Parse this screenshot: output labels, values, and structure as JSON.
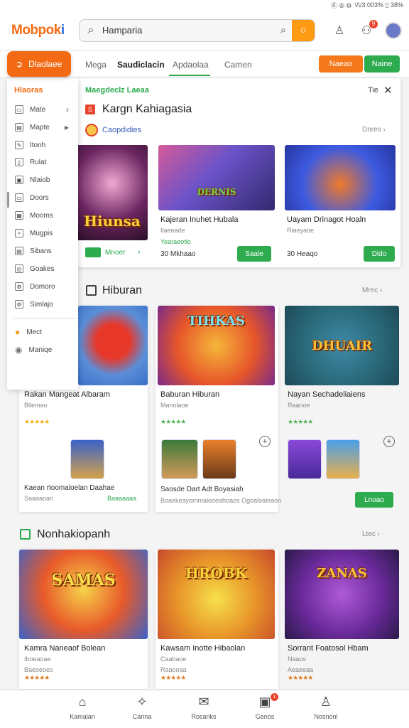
{
  "status": {
    "icons": "⓪ ✇ ⚙",
    "text": "\\/\\/3 003% ▯ 38%"
  },
  "app": {
    "logo_main": "Mobpok",
    "logo_tail": "i"
  },
  "search": {
    "value": "Hamparia"
  },
  "notifications": {
    "badge": "9"
  },
  "tabs": [
    {
      "label": "Mega"
    },
    {
      "label": "Saudiclacin"
    },
    {
      "label": "Apdaolaa"
    },
    {
      "label": "Camen"
    }
  ],
  "tab_buttons": {
    "orange": "Naeao",
    "green": "Naine"
  },
  "sidebar": {
    "button": "Dlaolaee",
    "head": "Hlaoras",
    "items": [
      {
        "label": "Mate",
        "icon": "card-icon",
        "glyph": "▭"
      },
      {
        "label": "Mapte",
        "icon": "map-icon",
        "glyph": "▤"
      },
      {
        "label": "Itonh",
        "icon": "edit-icon",
        "glyph": "✎"
      },
      {
        "label": "Rulat",
        "icon": "document-icon",
        "glyph": "▯"
      },
      {
        "label": "Nlaiob",
        "icon": "image-icon",
        "glyph": "▣"
      },
      {
        "label": "Doors",
        "icon": "door-icon",
        "glyph": "▭"
      },
      {
        "label": "Mooms",
        "icon": "gift-icon",
        "glyph": "▦"
      },
      {
        "label": "Mugpis",
        "icon": "search-icon",
        "glyph": "⌕"
      },
      {
        "label": "Sibans",
        "icon": "grid-icon",
        "glyph": "▤"
      },
      {
        "label": "Goakes",
        "icon": "game-icon",
        "glyph": "◎"
      },
      {
        "label": "Domoro",
        "icon": "settings-icon",
        "glyph": "⚙"
      },
      {
        "label": "Simlajo",
        "icon": "gear-icon",
        "glyph": "⚙"
      }
    ],
    "footer": [
      {
        "label": "Mect",
        "icon": "flame-icon"
      },
      {
        "label": "Maniqe",
        "icon": "profile-icon"
      }
    ]
  },
  "featured": {
    "top_label": "Maegdeclz  Laeaa",
    "top_right": "Tie",
    "title": "Kargn Kahiagasia",
    "subtitle": "Caopdidies",
    "more": "Dnres",
    "games": [
      {
        "art": "Hiunsa",
        "name": "",
        "sub": "",
        "price": "",
        "button": "Mnoer"
      },
      {
        "art": "DERNIS",
        "name": "Kajeran Inuhet Hubala",
        "sub": "Ilaeoade",
        "sub2": "Yearaeotlo",
        "price": "30 Mkhaao",
        "button": "Saale"
      },
      {
        "art": "",
        "name": "Uayam Drinagot Hoaln",
        "sub": "Riaeyaoe",
        "price": "30 Heaqo",
        "button": "Dldo"
      }
    ]
  },
  "section_hiburan": {
    "title": "Hiburan",
    "more": "Mrec",
    "games": [
      {
        "art": "",
        "name": "Rakan Mangeat Albaram",
        "sub": "Bllemao",
        "stars": "★★★★★",
        "sub_a": "Kaean rtoomaloelan  Daahae",
        "sub_b": "Saaaaoan",
        "sub_b_green": "Baaaaaaa"
      },
      {
        "art": "TIHKAS",
        "name": "Baburan Hiburan",
        "sub": "Manolaoe",
        "stars": "★★★★★",
        "sub_a": "Saosde Dart Adt Boyasiah",
        "sub_b": "Boaekeayommalooeahoaos Ogoaloaleaon"
      },
      {
        "art": "DHUAIR",
        "name": "Nayan Sechadeliaiens",
        "sub": "Raanoe",
        "stars": "★★★★★",
        "button": "Lnoao"
      }
    ]
  },
  "section_two": {
    "title": "Nonhakiopanh",
    "more": "Ltec",
    "games": [
      {
        "art": "SAMAS",
        "name": "Kamra Naneaof Bolean",
        "sub": "Iboeaoae",
        "sub2": "Baeoeoes",
        "stars": "★★★★★"
      },
      {
        "art": "HROBK",
        "name": "Kawsam Inotte Hibaolan",
        "sub": "Caabaoe",
        "sub2": "Raaooaa",
        "stars": "★★★★★"
      },
      {
        "art": "ZANAS",
        "name": "Sorrant Foatosol Hbam",
        "sub": "Naaos",
        "sub2": "Aeaeeaa",
        "stars": "★★★★★"
      }
    ]
  },
  "bottom_nav": [
    {
      "label": "Kamalan",
      "icon": "home-icon",
      "glyph": "⌂"
    },
    {
      "label": "Canna",
      "icon": "gamepad-icon",
      "glyph": "✧"
    },
    {
      "label": "Rocanks",
      "icon": "ticket-icon",
      "glyph": "✉"
    },
    {
      "label": "Genos",
      "icon": "games-icon",
      "glyph": "▣",
      "badge": "1"
    },
    {
      "label": "Nosnonl",
      "icon": "person-icon",
      "glyph": "♙"
    }
  ]
}
